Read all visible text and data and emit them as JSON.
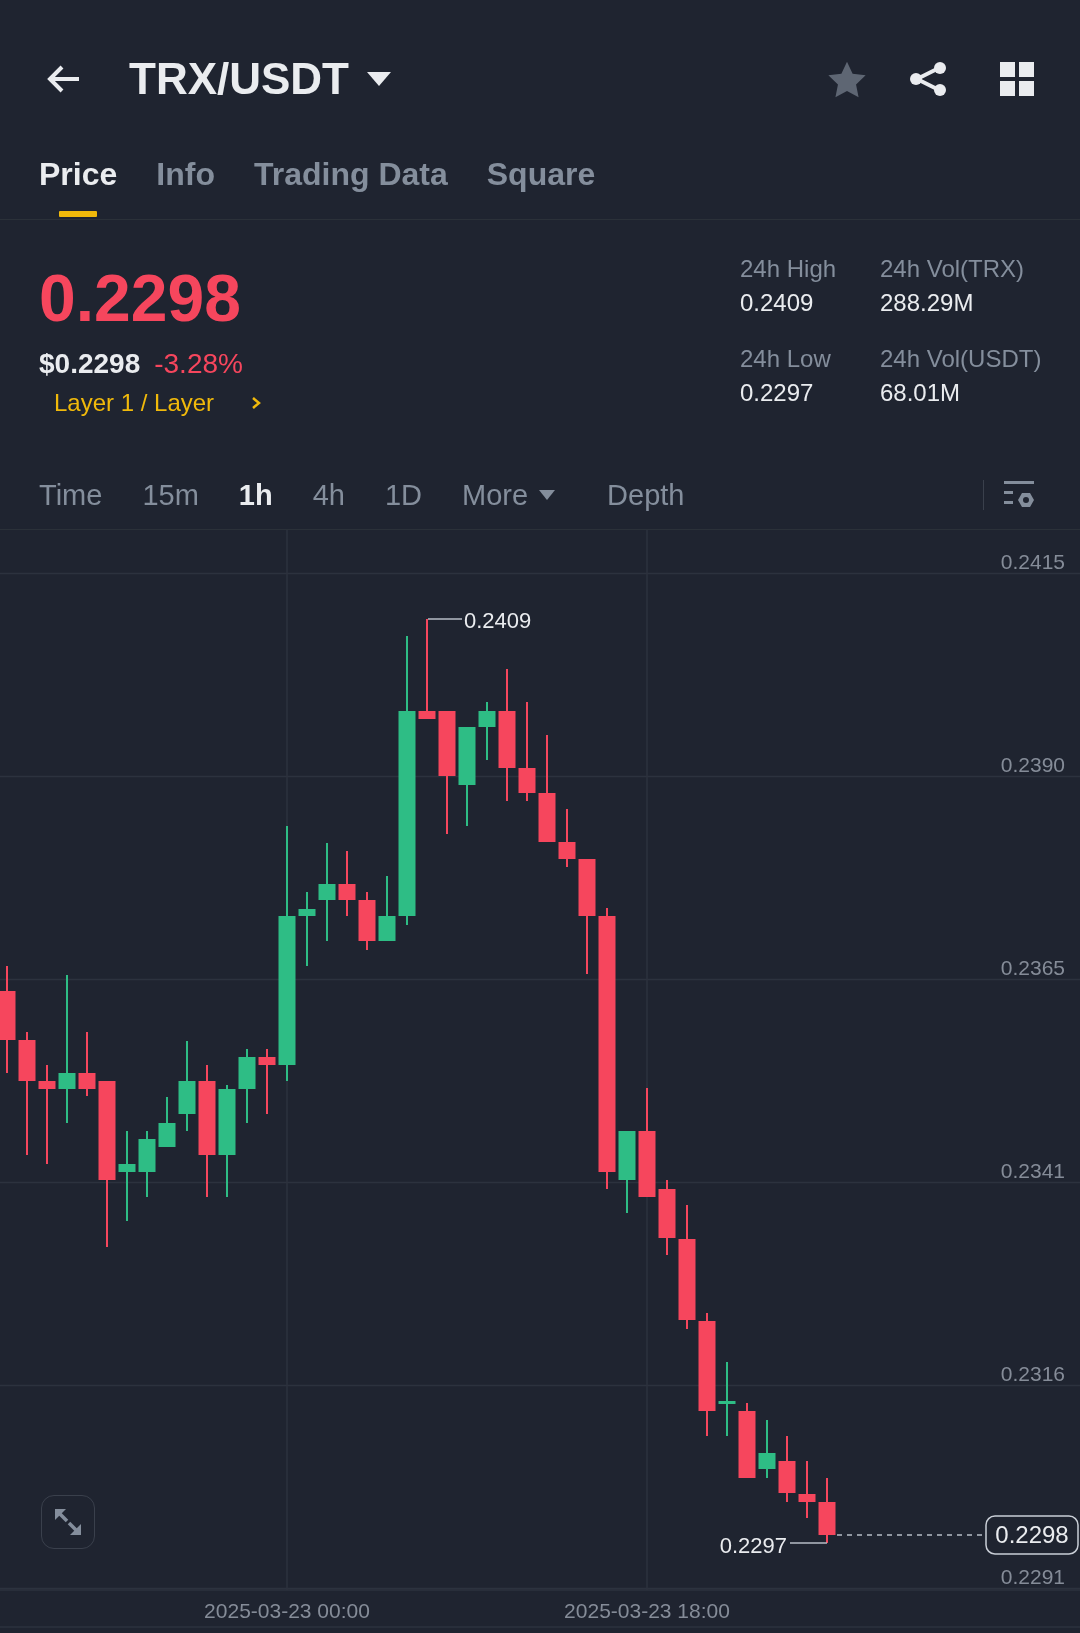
{
  "header": {
    "title": "TRX/USDT",
    "favorite": false
  },
  "tabs": [
    {
      "label": "Price",
      "selected": true
    },
    {
      "label": "Info",
      "selected": false
    },
    {
      "label": "Trading Data",
      "selected": false
    },
    {
      "label": "Square",
      "selected": false
    }
  ],
  "ticker": {
    "last_price": "0.2298",
    "falling": true,
    "usd_price": "$0.2298",
    "change": "-3.28%",
    "category_link": "Layer 1 / Layer"
  },
  "stats": [
    {
      "label": "24h High",
      "value": "0.2409"
    },
    {
      "label": "24h Vol(TRX)",
      "value": "288.29M"
    },
    {
      "label": "24h Low",
      "value": "0.2297"
    },
    {
      "label": "24h Vol(USDT)",
      "value": "68.01M"
    }
  ],
  "intervals": [
    {
      "label": "Time",
      "kind": "option",
      "selected": false
    },
    {
      "label": "15m",
      "kind": "option",
      "selected": false
    },
    {
      "label": "1h",
      "kind": "option",
      "selected": true
    },
    {
      "label": "4h",
      "kind": "option",
      "selected": false
    },
    {
      "label": "1D",
      "kind": "option",
      "selected": false
    },
    {
      "label": "More",
      "kind": "dropdown",
      "selected": false
    },
    {
      "label": "Depth",
      "kind": "option",
      "selected": false
    }
  ],
  "chart": {
    "price_axis": [
      "0.2415",
      "0.2390",
      "0.2365",
      "0.2341",
      "0.2316",
      "0.2291"
    ],
    "time_axis": [
      "2025-03-23 00:00",
      "2025-03-23 18:00"
    ],
    "high_label": "0.2409",
    "low_label": "0.2297",
    "last_price_tag": "0.2298"
  }
}
